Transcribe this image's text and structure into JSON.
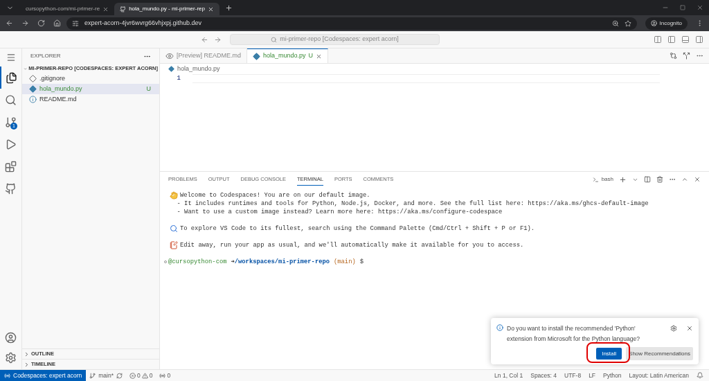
{
  "browser": {
    "tabs": [
      {
        "title": "cursopython-com/mi-primer-re",
        "selected": false
      },
      {
        "title": "hola_mundo.py - mi-primer-rep",
        "selected": true
      }
    ],
    "url": "expert-acorn-4jvr6wvrg66vhjxpj.github.dev",
    "profile": "Incognito"
  },
  "command_center": "mi-primer-repo [Codespaces: expert acorn]",
  "activity_bar": [
    {
      "kind": "files",
      "selected": true
    },
    {
      "kind": "search",
      "selected": false
    },
    {
      "kind": "source-control",
      "selected": false,
      "badge": "1"
    },
    {
      "kind": "run",
      "selected": false
    },
    {
      "kind": "extensions",
      "selected": false
    },
    {
      "kind": "github",
      "selected": false
    }
  ],
  "sidebar": {
    "title": "EXPLORER",
    "repo": {
      "label": "MI-PRIMER-REPO [CODESPACES: EXPERT ACORN]",
      "expanded": true
    },
    "files": [
      {
        "name": ".gitignore",
        "kind": "git",
        "selected": false
      },
      {
        "name": "hola_mundo.py",
        "kind": "python",
        "selected": true,
        "status": "U"
      },
      {
        "name": "README.md",
        "kind": "info",
        "selected": false
      }
    ],
    "sections": [
      {
        "label": "OUTLINE",
        "expanded": false
      },
      {
        "label": "TIMELINE",
        "expanded": false
      }
    ]
  },
  "editor": {
    "tabs": [
      {
        "title": "[Preview] README.md",
        "kind": "preview",
        "selected": false
      },
      {
        "title": "hola_mundo.py",
        "kind": "python",
        "selected": true,
        "status": "U"
      }
    ],
    "breadcrumb": "hola_mundo.py",
    "line_numbers": [
      "1"
    ]
  },
  "panel": {
    "tabs": [
      {
        "label": "PROBLEMS",
        "selected": false
      },
      {
        "label": "OUTPUT",
        "selected": false
      },
      {
        "label": "DEBUG CONSOLE",
        "selected": false
      },
      {
        "label": "TERMINAL",
        "selected": true
      },
      {
        "label": "PORTS",
        "selected": false
      },
      {
        "label": "COMMENTS",
        "selected": false
      }
    ],
    "shell": "bash",
    "lines": [
      {
        "kind": "wave",
        "text": "Welcome to Codespaces! You are on our default image."
      },
      {
        "kind": "plain",
        "text": "  - It includes runtimes and tools for Python, Node.js, Docker, and more. See the full list here: https://aka.ms/ghcs-default-image"
      },
      {
        "kind": "plain",
        "text": "  - Want to use a custom image instead? Learn more here: https://aka.ms/configure-codespace",
        "gap_after": true
      },
      {
        "kind": "search",
        "text": "To explore VS Code to its fullest, search using the Command Palette (Cmd/Ctrl + Shift + P or F1).",
        "gap_after": true
      },
      {
        "kind": "memo",
        "text": "Edit away, run your app as usual, and we'll automatically make it available for you to access.",
        "gap_after": true
      }
    ],
    "prompt": {
      "user": "@cursopython-com",
      "arrow": "➜",
      "path": "/workspaces/mi-primer-repo",
      "branch": "(main)",
      "symbol": "$"
    }
  },
  "notification": {
    "message": "Do you want to install the recommended 'Python' extension from Microsoft for the Python language?",
    "primary": "Install",
    "secondary": "Show Recommendations"
  },
  "status_bar": {
    "remote": "Codespaces: expert acorn",
    "branch": "main*",
    "errors": "0",
    "warnings": "0",
    "ports": "0",
    "right": [
      "Ln 1, Col 1",
      "Spaces: 4",
      "UTF-8",
      "LF",
      "Python",
      "Layout: Latin American"
    ]
  }
}
